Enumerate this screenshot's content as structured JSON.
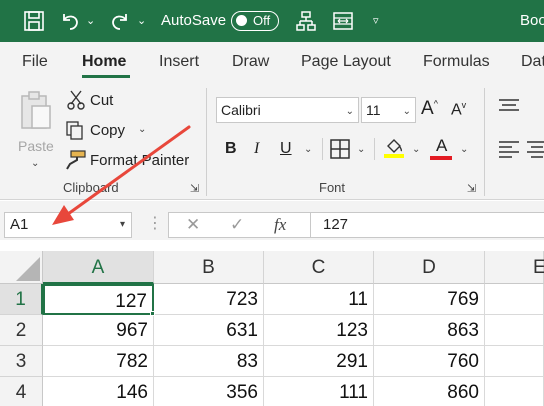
{
  "titlebar": {
    "autosave_label": "AutoSave",
    "autosave_state": "Off",
    "doc_title": "Boo",
    "bg_color": "#217346",
    "icons": [
      "save-icon",
      "undo-icon",
      "redo-icon",
      "org-chart-icon",
      "sheet-fit-icon",
      "customize-qat-icon"
    ]
  },
  "tabs": [
    {
      "label": "File"
    },
    {
      "label": "Home",
      "active": true
    },
    {
      "label": "Insert"
    },
    {
      "label": "Draw"
    },
    {
      "label": "Page Layout"
    },
    {
      "label": "Formulas"
    },
    {
      "label": "Dat"
    }
  ],
  "clipboard": {
    "paste_label": "Paste",
    "cut_label": "Cut",
    "copy_label": "Copy",
    "format_painter_label": "Format Painter",
    "group_label": "Clipboard"
  },
  "font": {
    "font_name": "Calibri",
    "font_size": "11",
    "group_label": "Font",
    "font_color": "#e31b23",
    "highlight_color": "#ffff00"
  },
  "formula_bar": {
    "name_box": "A1",
    "value": "127",
    "fx_label": "fx"
  },
  "grid": {
    "columns": [
      "A",
      "B",
      "C",
      "D",
      "E"
    ],
    "rows": [
      {
        "num": "1",
        "cells": [
          "127",
          "723",
          "11",
          "769"
        ]
      },
      {
        "num": "2",
        "cells": [
          "967",
          "631",
          "123",
          "863"
        ]
      },
      {
        "num": "3",
        "cells": [
          "782",
          "83",
          "291",
          "760"
        ]
      },
      {
        "num": "4",
        "cells": [
          "146",
          "356",
          "111",
          "860"
        ]
      }
    ],
    "active_cell": "A1"
  },
  "annotation": {
    "arrow_color": "#e8473b"
  }
}
